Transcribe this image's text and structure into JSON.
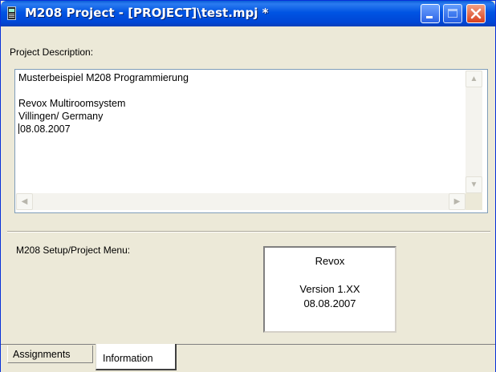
{
  "window": {
    "title": "M208 Project - [PROJECT]\\test.mpj *",
    "app_icon": "handheld-device-icon",
    "buttons": {
      "minimize": "minimize-icon",
      "maximize": "maximize-icon",
      "close": "close-icon"
    }
  },
  "description": {
    "label": "Project Description:",
    "lines": [
      "Musterbeispiel M208 Programmierung",
      "",
      "Revox Multiroomsystem",
      "Villingen/ Germany",
      "08.08.2007"
    ]
  },
  "setup_menu": {
    "label": "M208 Setup/Project Menu:"
  },
  "info_box": {
    "brand": "Revox",
    "version": "Version 1.XX",
    "date": "08.08.2007"
  },
  "tabs": [
    {
      "label": "Assignments",
      "active": false
    },
    {
      "label": "Information",
      "active": true
    }
  ],
  "colors": {
    "title_bar": "#0054e3",
    "close_button": "#d8401d",
    "window_bg": "#ece9d8"
  }
}
